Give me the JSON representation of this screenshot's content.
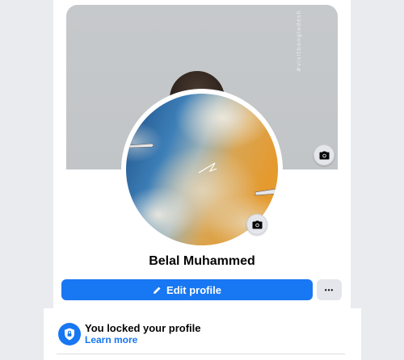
{
  "profile": {
    "cover_watermark": "#visitbangladesh",
    "name": "Belal Muhammed"
  },
  "actions": {
    "edit_profile_label": "Edit profile",
    "more_label": "•••"
  },
  "lock_notice": {
    "title": "You locked your profile",
    "link": "Learn more"
  },
  "icons": {
    "cover_camera": "camera-icon",
    "avatar_camera": "camera-icon",
    "edit": "pencil-icon",
    "lock": "shield-lock-icon"
  },
  "colors": {
    "accent": "#1877f2",
    "secondary_button": "#e4e6eb"
  }
}
